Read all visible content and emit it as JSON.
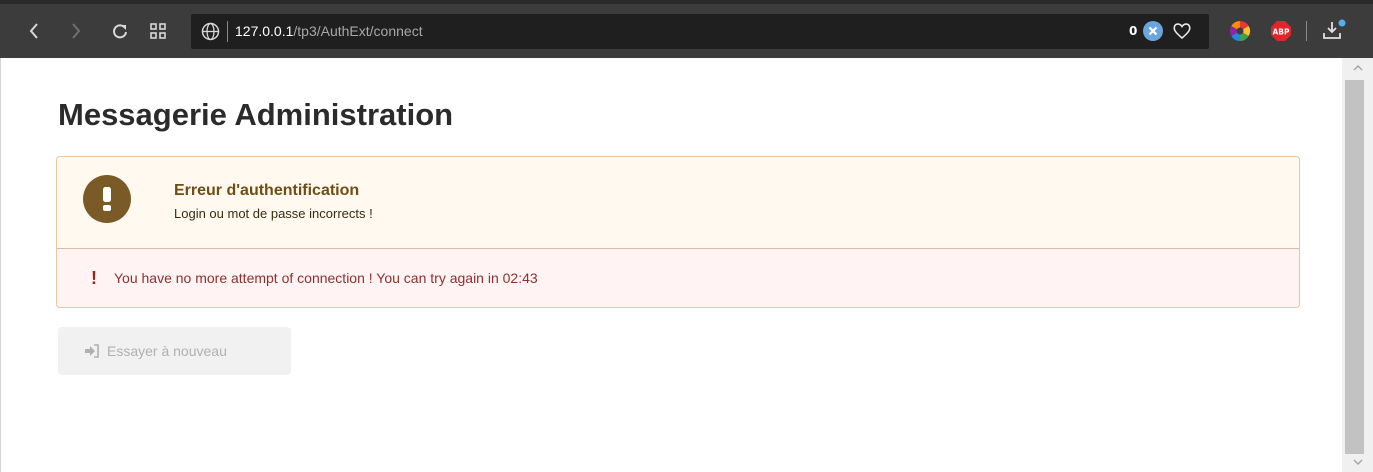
{
  "browser": {
    "url_host": "127.0.0.1",
    "url_path": "/tp3/AuthExt/connect",
    "blocked_count": "0",
    "abp_label": "ABP",
    "icons": {
      "back": "chevron-left-icon",
      "forward": "chevron-right-icon",
      "reload": "reload-icon",
      "speed_dial": "grid-icon",
      "site_info": "globe-icon",
      "blocker": "x-circle-icon",
      "bookmark": "heart-icon",
      "extension": "color-wheel-icon",
      "adblock": "abp-icon",
      "downloads": "download-icon"
    }
  },
  "page": {
    "title": "Messagerie Administration"
  },
  "auth_error": {
    "title": "Erreur d'authentification",
    "message": "Login ou mot de passe incorrects !",
    "icon": "exclamation-circle-icon",
    "attempt_icon": "exclamation-icon",
    "attempt_symbol": "!",
    "attempt_message": "You have no more attempt of connection ! You can try again in 02:43"
  },
  "retry_button": {
    "label": "Essayer à nouveau",
    "icon": "sign-in-icon",
    "enabled": false
  },
  "colors": {
    "toolbar": "#3c3c3c",
    "warning_bg": "#fff9ef",
    "warning_text": "#6f4e16",
    "warning_icon": "#7a5a27",
    "error_bg": "#fff3f3",
    "error_text": "#8f3030",
    "error_icon": "#a3201d"
  }
}
